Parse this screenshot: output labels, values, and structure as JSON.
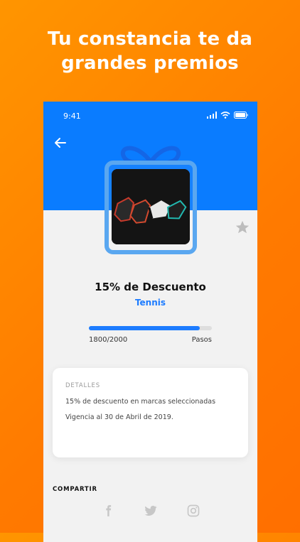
{
  "headline": {
    "line1": "Tu constancia te da",
    "line2": "grandes premios"
  },
  "status_bar": {
    "time": "9:41",
    "icons": [
      "signal-icon",
      "wifi-icon",
      "battery-icon"
    ]
  },
  "reward": {
    "title": "15% de Descuento",
    "category": "Tennis",
    "progress_current_label": "1800/2000",
    "progress_unit_label": "Pasos",
    "progress_value": 0.9
  },
  "details": {
    "label": "DETALLES",
    "line1": "15% de descuento en marcas seleccionadas",
    "line2": "Vigencia al 30 de Abril de 2019."
  },
  "share": {
    "title": "COMPARTIR",
    "icons": [
      "facebook-icon",
      "twitter-icon",
      "instagram-icon"
    ]
  },
  "colors": {
    "accent_orange": "#ff8c00",
    "primary_blue": "#0a7cff",
    "link_blue": "#1d7cff",
    "background": "#f2f2f2",
    "muted_gray": "#9a9a9a"
  }
}
